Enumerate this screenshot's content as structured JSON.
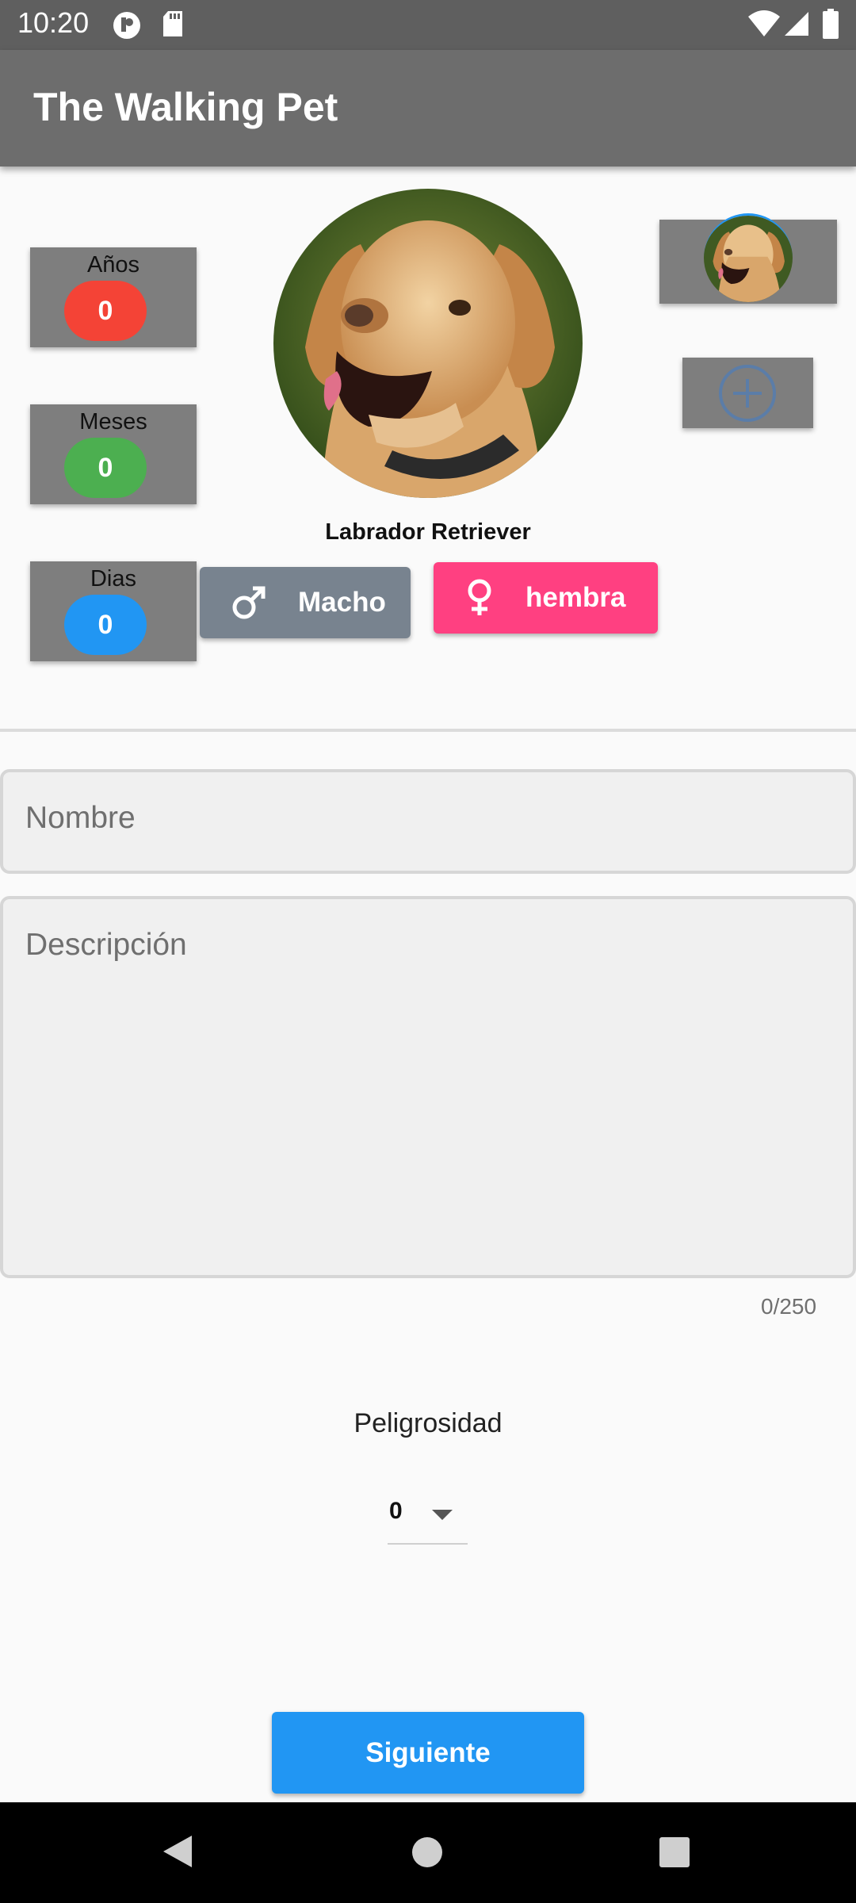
{
  "status_bar": {
    "time": "10:20"
  },
  "app_bar": {
    "title": "The Walking Pet"
  },
  "age": {
    "years": {
      "label": "Años",
      "value": "0",
      "color": "#f44336"
    },
    "months": {
      "label": "Meses",
      "value": "0",
      "color": "#4caf50"
    },
    "days": {
      "label": "Dias",
      "value": "0",
      "color": "#2196f3"
    }
  },
  "breed": {
    "name": "Labrador Retriever"
  },
  "gender": {
    "male_label": "Macho",
    "female_label": "hembra",
    "selected": "hembra",
    "male_color": "#78838f",
    "female_color": "#ff4081"
  },
  "form": {
    "name_placeholder": "Nombre",
    "description_placeholder": "Descripción",
    "description_counter": "0/250"
  },
  "danger": {
    "label": "Peligrosidad",
    "value": "0"
  },
  "next_button": {
    "label": "Siguiente"
  },
  "icons": [
    "user-badge-icon",
    "sd-card-icon",
    "wifi-icon",
    "signal-icon",
    "battery-icon",
    "male-icon",
    "female-icon",
    "add-circle-icon",
    "back-icon",
    "home-icon",
    "recents-icon"
  ]
}
